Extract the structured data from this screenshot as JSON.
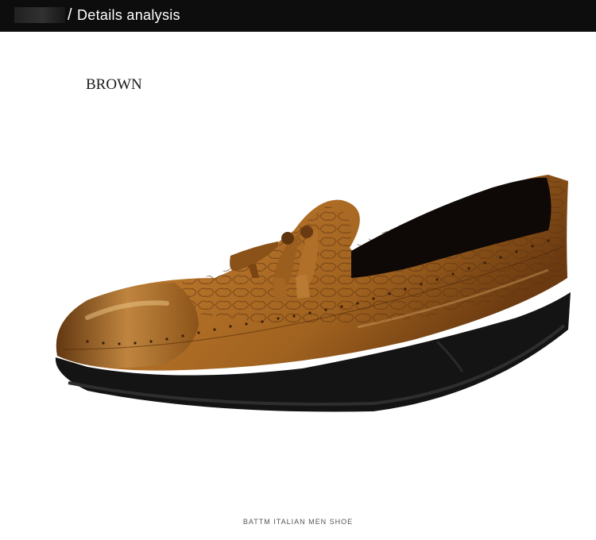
{
  "header": {
    "title": "Details analysis",
    "separator": "/"
  },
  "product": {
    "color_label": "BROWN",
    "leather_color": "#a0621f",
    "sole_color": "#141414"
  },
  "footer": {
    "caption": "BATTM ITALIAN MEN SHOE"
  }
}
